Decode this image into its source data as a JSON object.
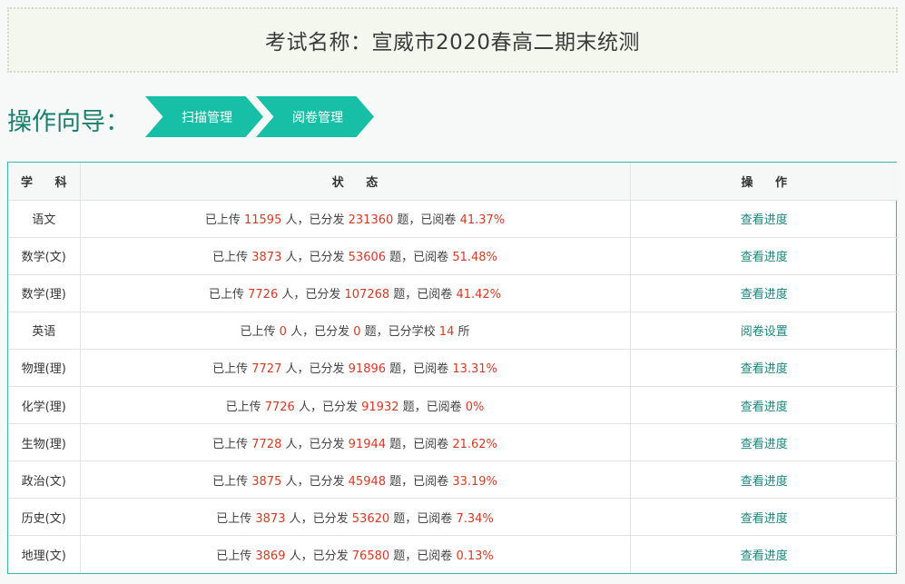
{
  "exam": {
    "title": "考试名称：宣威市2020春高二期末统测"
  },
  "guide": {
    "label": "操作向导：",
    "steps": [
      {
        "label": "扫描管理"
      },
      {
        "label": "阅卷管理"
      }
    ]
  },
  "table": {
    "headers": {
      "subject": "学 科",
      "status": "状 态",
      "action": "操 作"
    },
    "rows": [
      {
        "subject": "语文",
        "p1": "已上传",
        "uploaded": "11595",
        "p2": "人，已分发",
        "distributed": "231360",
        "p3": "题，已阅卷",
        "progress": "41.37%",
        "p4": "",
        "action": "查看进度"
      },
      {
        "subject": "数学(文)",
        "p1": "已上传",
        "uploaded": "3873",
        "p2": "人，已分发",
        "distributed": "53606",
        "p3": "题，已阅卷",
        "progress": "51.48%",
        "p4": "",
        "action": "查看进度"
      },
      {
        "subject": "数学(理)",
        "p1": "已上传",
        "uploaded": "7726",
        "p2": "人，已分发",
        "distributed": "107268",
        "p3": "题，已阅卷",
        "progress": "41.42%",
        "p4": "",
        "action": "查看进度"
      },
      {
        "subject": "英语",
        "p1": "已上传",
        "uploaded": "0",
        "p2": "人，已分发",
        "distributed": "0",
        "p3": "题，已分学校",
        "progress": "14",
        "p4": "所",
        "action": "阅卷设置"
      },
      {
        "subject": "物理(理)",
        "p1": "已上传",
        "uploaded": "7727",
        "p2": "人，已分发",
        "distributed": "91896",
        "p3": "题，已阅卷",
        "progress": "13.31%",
        "p4": "",
        "action": "查看进度"
      },
      {
        "subject": "化学(理)",
        "p1": "已上传",
        "uploaded": "7726",
        "p2": "人，已分发",
        "distributed": "91932",
        "p3": "题，已阅卷",
        "progress": "0%",
        "p4": "",
        "action": "查看进度"
      },
      {
        "subject": "生物(理)",
        "p1": "已上传",
        "uploaded": "7728",
        "p2": "人，已分发",
        "distributed": "91944",
        "p3": "题，已阅卷",
        "progress": "21.62%",
        "p4": "",
        "action": "查看进度"
      },
      {
        "subject": "政治(文)",
        "p1": "已上传",
        "uploaded": "3875",
        "p2": "人，已分发",
        "distributed": "45948",
        "p3": "题，已阅卷",
        "progress": "33.19%",
        "p4": "",
        "action": "查看进度"
      },
      {
        "subject": "历史(文)",
        "p1": "已上传",
        "uploaded": "3873",
        "p2": "人，已分发",
        "distributed": "53620",
        "p3": "题，已阅卷",
        "progress": "7.34%",
        "p4": "",
        "action": "查看进度"
      },
      {
        "subject": "地理(文)",
        "p1": "已上传",
        "uploaded": "3869",
        "p2": "人，已分发",
        "distributed": "76580",
        "p3": "题，已阅卷",
        "progress": "0.13%",
        "p4": "",
        "action": "查看进度"
      }
    ]
  },
  "colors": {
    "accent": "#16bfa6",
    "link": "#19857a",
    "number": "#d63a24",
    "border": "#34b9a6"
  }
}
